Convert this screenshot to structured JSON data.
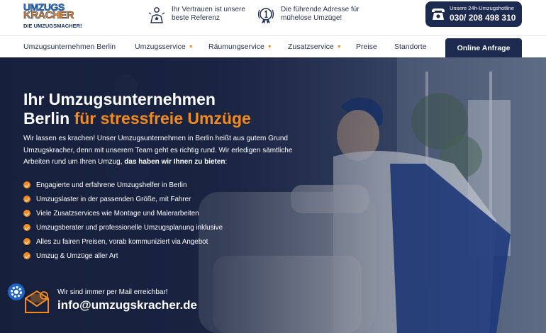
{
  "brand": {
    "logo_line1": "UMZUGS",
    "logo_line2": "KRACHER",
    "logo_tagline": "DIE UMZUGSMACHER!"
  },
  "header": {
    "usp": [
      {
        "icon": "trophy-person-icon",
        "text": "Ihr Vertrauen ist unsere beste Referenz"
      },
      {
        "icon": "medal-number-one-icon",
        "text": "Die führende Adresse für mühelose Umzüge!"
      }
    ],
    "hotline": {
      "icon": "phone-icon",
      "label": "Unsere 24h-Umzugshotline",
      "number": "030/ 208 498 310"
    }
  },
  "nav": {
    "items": [
      {
        "label": "Umzugsunternehmen Berlin",
        "dropdown": false
      },
      {
        "label": "Umzugsservice",
        "dropdown": true
      },
      {
        "label": "Räumungservice",
        "dropdown": true
      },
      {
        "label": "Zusatzservice",
        "dropdown": true
      },
      {
        "label": "Preise",
        "dropdown": false
      },
      {
        "label": "Standorte",
        "dropdown": false
      }
    ],
    "cta_label": "Online Anfrage"
  },
  "hero": {
    "title_line1": "Ihr Umzugsunternehmen",
    "title_line2_plain": "Berlin ",
    "title_line2_accent": "für stressfreie Umzüge",
    "intro_text": "Wir lassen es krachen! Unser Umzugsunternehmen in Berlin heißt aus gutem Grund Umzugskracher, denn mit unserem Team geht es richtig rund. Wir erledigen sämtliche Arbeiten rund um Ihren Umzug, ",
    "intro_bold": "das haben wir Ihnen zu bieten",
    "intro_end": ":",
    "bullets": [
      "Engagierte und erfahrene Umzugshelfer in Berlin",
      "Umzugslaster in der passenden Größe, mit Fahrer",
      "Viele Zusatzservices wie Montage und Malerarbeiten",
      "Umzugsberater und professionelle Umzugsplanung inklusive",
      "Alles zu fairen Preisen, vorab kommuniziert via Angebot",
      "Umzug & Umzüge aller Art"
    ],
    "mail_label": "Wir sind immer per Mail erreichbar!",
    "mail_address": "info@umzugskracher.de"
  },
  "colors": {
    "accent_orange": "#f28a1e",
    "navy": "#1d2a4f",
    "logo_blue": "#2c7fd1"
  }
}
